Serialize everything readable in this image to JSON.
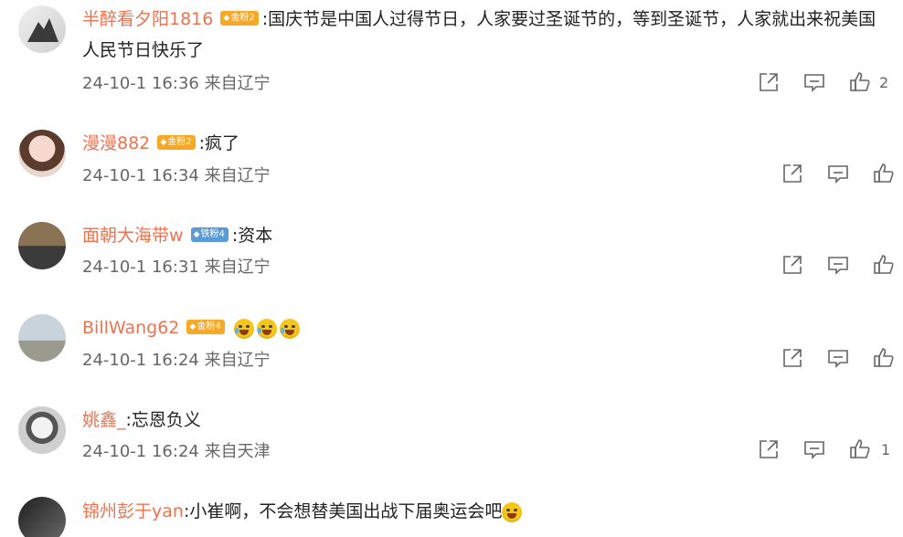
{
  "comments": [
    {
      "username": "半醉看夕阳1816",
      "badge": "金粉2",
      "text": ":国庆节是中国人过得节日，人家要过圣诞节的，等到圣诞节，人家就出来祝美国人民节日快乐了",
      "time": "24-10-1 16:36",
      "location": "来自辽宁",
      "likes": "2"
    },
    {
      "username": "漫漫882",
      "badge": "金粉2",
      "text": ":疯了",
      "time": "24-10-1 16:34",
      "location": "来自辽宁",
      "likes": ""
    },
    {
      "username": "面朝大海带w",
      "badge": "铁粉4",
      "text": ":资本",
      "time": "24-10-1 16:31",
      "location": "来自辽宁",
      "likes": ""
    },
    {
      "username": "BillWang62",
      "badge": "金粉4",
      "text": "",
      "time": "24-10-1 16:24",
      "location": "来自辽宁",
      "likes": ""
    },
    {
      "username": "姚鑫_",
      "badge": "",
      "text": ":忘恩负义",
      "time": "24-10-1 16:24",
      "location": "来自天津",
      "likes": "1"
    },
    {
      "username": "锦州彭于yan",
      "badge": "",
      "text": ":小崔啊，不会想替美国出战下届奥运会吧",
      "time": "",
      "location": "",
      "likes": ""
    }
  ],
  "icons": {
    "share": "share-icon",
    "comment": "comment-icon",
    "like": "like-icon",
    "emoji": "laugh-cry-emoji"
  },
  "colors": {
    "username": "#eb7350",
    "meta": "#666666",
    "gold_badge": "#f9a825",
    "iron_badge": "#5b9bd5"
  }
}
